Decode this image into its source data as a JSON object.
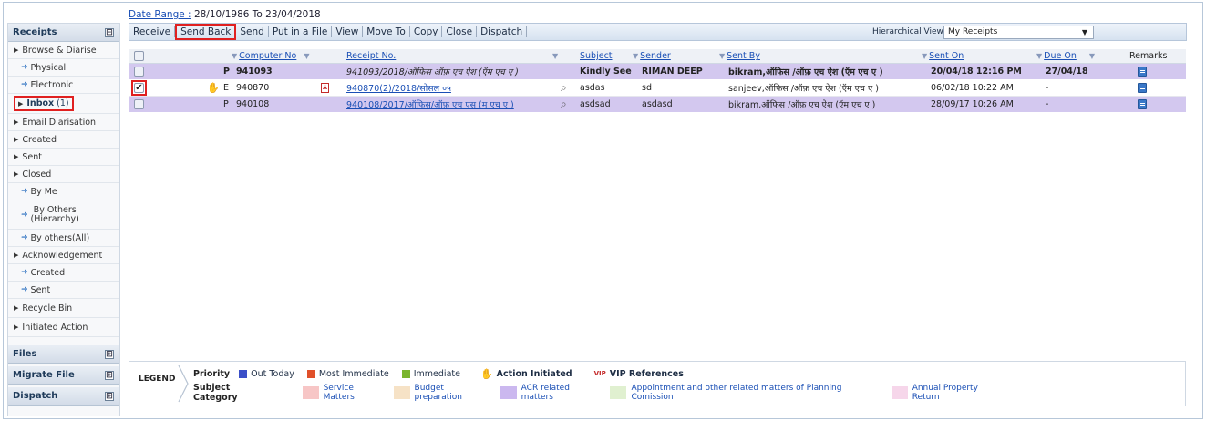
{
  "date_range": {
    "label": "Date Range :",
    "value": "28/10/1986 To 23/04/2018"
  },
  "sidebar": {
    "receipts_title": "Receipts",
    "collapse_symbol": "⊟",
    "expand_symbol": "⊞",
    "items": [
      {
        "label": "Browse & Diarise",
        "kind": "parent"
      },
      {
        "label": "Physical",
        "kind": "child"
      },
      {
        "label": "Electronic",
        "kind": "child"
      },
      {
        "label": "Inbox",
        "count": "(1)",
        "kind": "inbox"
      },
      {
        "label": "Email Diarisation",
        "kind": "parent"
      },
      {
        "label": "Created",
        "kind": "parent"
      },
      {
        "label": "Sent",
        "kind": "parent"
      },
      {
        "label": "Closed",
        "kind": "parent"
      },
      {
        "label": "By Me",
        "kind": "child"
      },
      {
        "label": "By Others\n(Hierarchy)",
        "kind": "child-tall"
      },
      {
        "label": "By others(All)",
        "kind": "child"
      },
      {
        "label": "Acknowledgement",
        "kind": "parent"
      },
      {
        "label": "Created",
        "kind": "child"
      },
      {
        "label": "Sent",
        "kind": "child"
      },
      {
        "label": "Recycle Bin",
        "kind": "parent"
      },
      {
        "label": "Initiated Action",
        "kind": "parent"
      }
    ],
    "sections": [
      "Files",
      "Migrate File",
      "Dispatch"
    ]
  },
  "toolbar": {
    "buttons": [
      "Receive",
      "Send Back",
      "Send",
      "Put in a File",
      "View",
      "Move To",
      "Copy",
      "Close",
      "Dispatch"
    ],
    "hierarchical_view_label": "Hierarchical View",
    "hierarchical_view_value": "My Receipts"
  },
  "table": {
    "headers": {
      "computer_no": "Computer No",
      "receipt_no": "Receipt No.",
      "subject": "Subject",
      "sender": "Sender",
      "sent_by": "Sent By",
      "sent_on": "Sent On",
      "due_on": "Due On",
      "remarks": "Remarks"
    },
    "rows": [
      {
        "checked": false,
        "type": "P",
        "computer_no": "941093",
        "receipt_no": "941093/2018/ऑफिस ऑफ़ एच ऐश (ऍम एच ए )",
        "subject": "Kindly See",
        "sender": "RIMAN DEEP",
        "sent_by": "bikram,ऑफिस /ऑफ़ एच ऐश (ऍम एच ए )",
        "sent_on": "20/04/18 12:16 PM",
        "due_on": "27/04/18",
        "style": "purple-bold"
      },
      {
        "checked": true,
        "type": "E",
        "computer_no": "940870",
        "receipt_no": "940870(2)/2018/सोसल ०५",
        "subject": "asdas",
        "sender": "sd",
        "sent_by": "sanjeev,ऑफिस /ऑफ़ एच ऐश (ऍम एच ए )",
        "sent_on": "06/02/18 10:22 AM",
        "due_on": "-",
        "style": "white"
      },
      {
        "checked": false,
        "type": "P",
        "computer_no": "940108",
        "receipt_no": "940108/2017/ऑफिस/ऑफ़ एच एस (म एच ए )",
        "subject": "asdsad",
        "sender": "asdasd",
        "sent_by": "bikram,ऑफिस /ऑफ़ एच ऐश (ऍम एच ए )",
        "sent_on": "28/09/17 10:26 AM",
        "due_on": "-",
        "style": "purple"
      }
    ]
  },
  "legend": {
    "tag": "LEGEND",
    "priority_label": "Priority",
    "priorities": [
      {
        "label": "Out Today",
        "color": "#3b4fc8"
      },
      {
        "label": "Most Immediate",
        "color": "#e0502a"
      },
      {
        "label": "Immediate",
        "color": "#7ab52e"
      }
    ],
    "action_initiated": "Action Initiated",
    "vip_badge": "VIP",
    "vip_references": "VIP References",
    "subject_category_label": "Subject Category",
    "categories": [
      {
        "label": "Service Matters",
        "color": "#f7c6c6"
      },
      {
        "label": "Budget preparation",
        "color": "#f6e2c6"
      },
      {
        "label": "ACR related matters",
        "color": "#cbb8ef"
      },
      {
        "label": "Appointment and other related matters of Planning Comission",
        "color": "#e0f0d0"
      },
      {
        "label": "Annual Property Return",
        "color": "#f6d6ea"
      }
    ]
  },
  "colors": {
    "row_purple": "#d3c8ef",
    "highlight_red": "#e02020",
    "link_blue": "#1a4fb5"
  }
}
